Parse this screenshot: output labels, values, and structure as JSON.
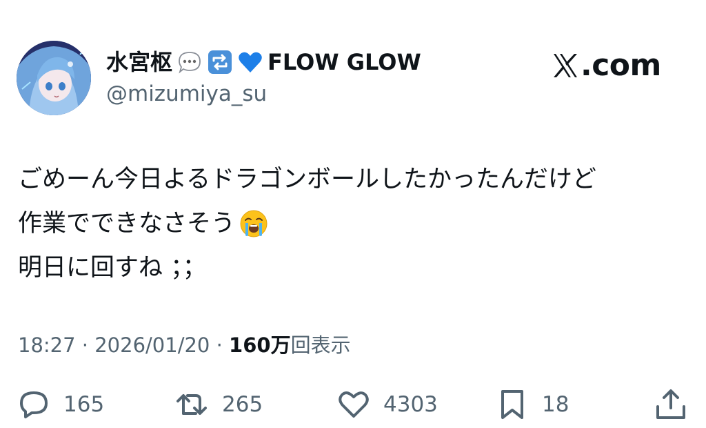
{
  "user": {
    "display_name": "水宮枢",
    "badge_text": "FLOW GLOW",
    "handle": "@mizumiya_su",
    "avatar_icon": "anime-avatar"
  },
  "brand": {
    "label": ".com",
    "icon": "x-logo-icon"
  },
  "tweet": {
    "lines": [
      "ごめーん今日よるドラゴンボールしたかったんだけど",
      "作業でできなさそう",
      "明日に回すね ；；"
    ],
    "emoji": "loudly-crying-face"
  },
  "meta": {
    "time": "18:27",
    "separator": "·",
    "date": "2026/01/20",
    "views_count": "160万",
    "views_label": "回表示"
  },
  "actions": {
    "replies": "165",
    "reposts": "265",
    "likes": "4303",
    "bookmarks": "18"
  },
  "colors": {
    "text": "#0f1419",
    "secondary": "#536471",
    "heart_blue": "#1d9bf0"
  }
}
